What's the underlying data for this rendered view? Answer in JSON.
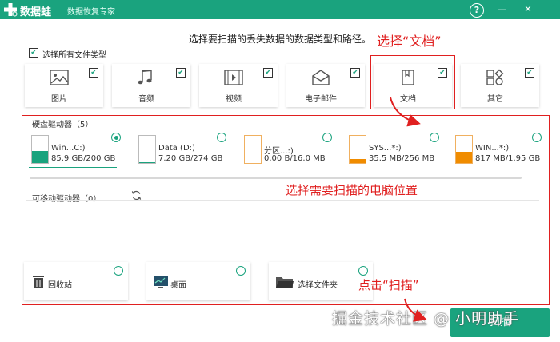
{
  "app": {
    "name": "数据蛙",
    "subtitle": "数据恢复专家",
    "brand_color": "#1aa37e"
  },
  "titlebar": {
    "help_label": "?",
    "minimize_label": "—",
    "close_label": "✕"
  },
  "header": {
    "instruction": "选择要扫描的丢失数据的数据类型和路径。"
  },
  "annotations": {
    "select_docs": "选择“文档”",
    "select_location": "选择需要扫描的电脑位置",
    "click_scan": "点击“扫描”",
    "accent_color": "#e02020"
  },
  "select_all": {
    "label": "选择所有文件类型",
    "checked": true
  },
  "file_types": [
    {
      "label": "图片",
      "icon": "image-icon",
      "checked": true
    },
    {
      "label": "音频",
      "icon": "music-icon",
      "checked": true
    },
    {
      "label": "视频",
      "icon": "video-icon",
      "checked": true
    },
    {
      "label": "电子邮件",
      "icon": "mail-icon",
      "checked": true
    },
    {
      "label": "文档",
      "icon": "document-icon",
      "checked": true
    },
    {
      "label": "其它",
      "icon": "other-icon",
      "checked": true
    }
  ],
  "hard_drives": {
    "title": "硬盘驱动器（5）",
    "items": [
      {
        "name": "Win...C:)",
        "size": "85.9 GB/200 GB",
        "used": 0.43,
        "color": "#1aa37e",
        "selected": true
      },
      {
        "name": "Data (D:)",
        "size": "7.20 GB/274 GB",
        "used": 0.03,
        "color": "#1aa37e",
        "selected": false
      },
      {
        "name": "分区...:)",
        "size": "0.00  B/16.0 MB",
        "used": 0.0,
        "color": "#f08c00",
        "selected": false
      },
      {
        "name": "SYS...*:)",
        "size": "35.5 MB/256 MB",
        "used": 0.14,
        "color": "#f08c00",
        "selected": false
      },
      {
        "name": "WIN...*:)",
        "size": "817 MB/1.95 GB",
        "used": 0.42,
        "color": "#f08c00",
        "selected": false
      }
    ]
  },
  "removable": {
    "title": "可移动驱动器（0）",
    "refresh_icon": "refresh-icon"
  },
  "locations": [
    {
      "label": "回收站",
      "icon": "trash-icon"
    },
    {
      "label": "桌面",
      "icon": "desktop-icon"
    },
    {
      "label": "选择文件夹",
      "icon": "folder-icon"
    }
  ],
  "scan_button": {
    "label": "扫描"
  },
  "watermark": "掘金技术社区 @ 小明助手"
}
